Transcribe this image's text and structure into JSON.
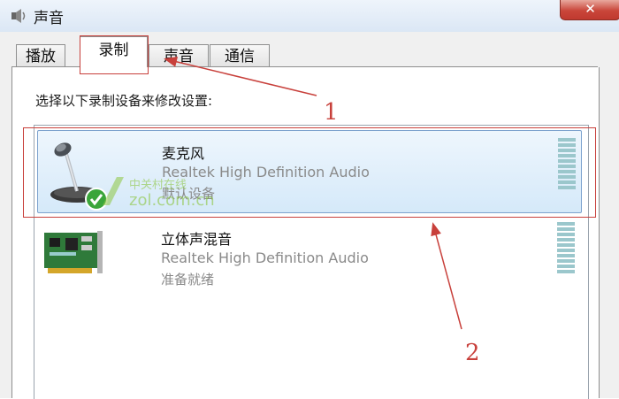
{
  "window": {
    "title": "声音",
    "close_glyph": "✕"
  },
  "tabs": [
    {
      "label": "播放",
      "selected": false
    },
    {
      "label": "录制",
      "selected": true
    },
    {
      "label": "声音",
      "selected": false
    },
    {
      "label": "通信",
      "selected": false
    }
  ],
  "instruction": "选择以下录制设备来修改设置:",
  "devices": [
    {
      "name": "麦克风",
      "driver": "Realtek High Definition Audio",
      "status": "默认设备",
      "icon": "microphone-icon",
      "badge": "default-check-icon",
      "selected": true
    },
    {
      "name": "立体声混音",
      "driver": "Realtek High Definition Audio",
      "status": "准备就绪",
      "icon": "sound-card-icon",
      "selected": false
    }
  ],
  "annotations": [
    {
      "number": "1",
      "target": "tab-recording"
    },
    {
      "number": "2",
      "target": "device-microphone"
    }
  ],
  "watermark": {
    "top": "中关村在线",
    "bottom": "zol.com.cn"
  },
  "colors": {
    "annotation": "#c8403b",
    "selection": "#d5e9f9",
    "level_meter": "#9bc7cc"
  }
}
